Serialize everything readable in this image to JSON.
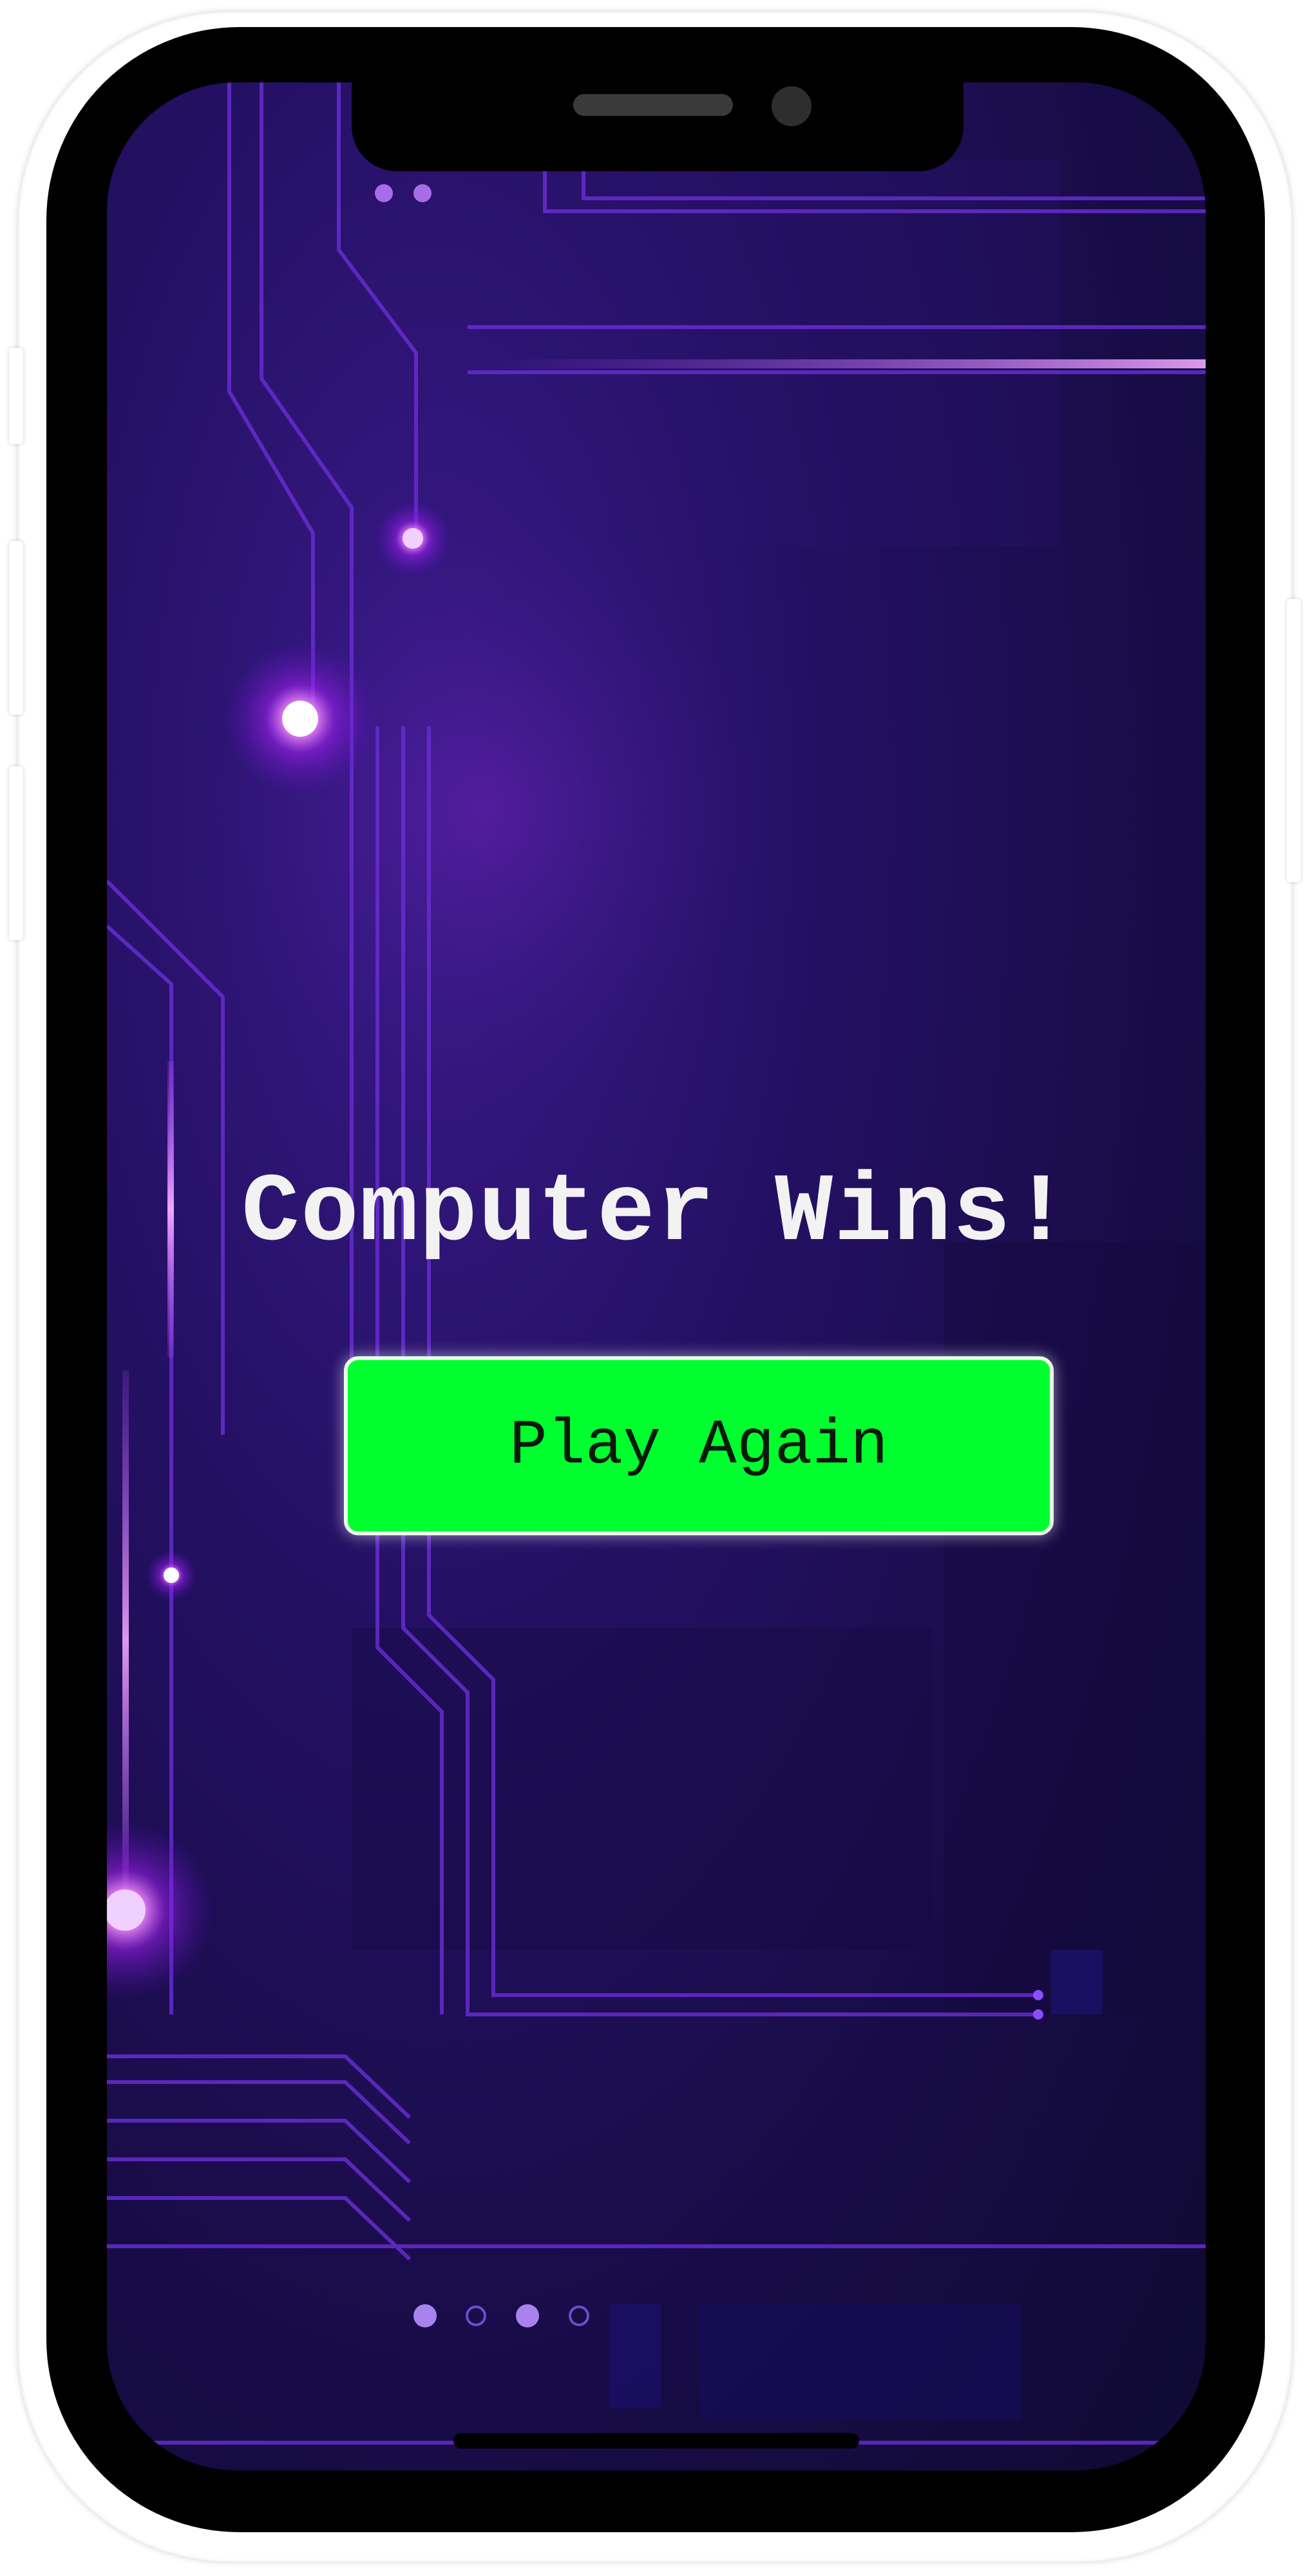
{
  "game": {
    "result_text": "Computer Wins!",
    "play_again_label": "Play Again"
  },
  "colors": {
    "button_bg": "#00ff2e",
    "title_text": "#f2f2f2",
    "background": "#1a0d4d",
    "circuit_glow": "#b44dff"
  }
}
